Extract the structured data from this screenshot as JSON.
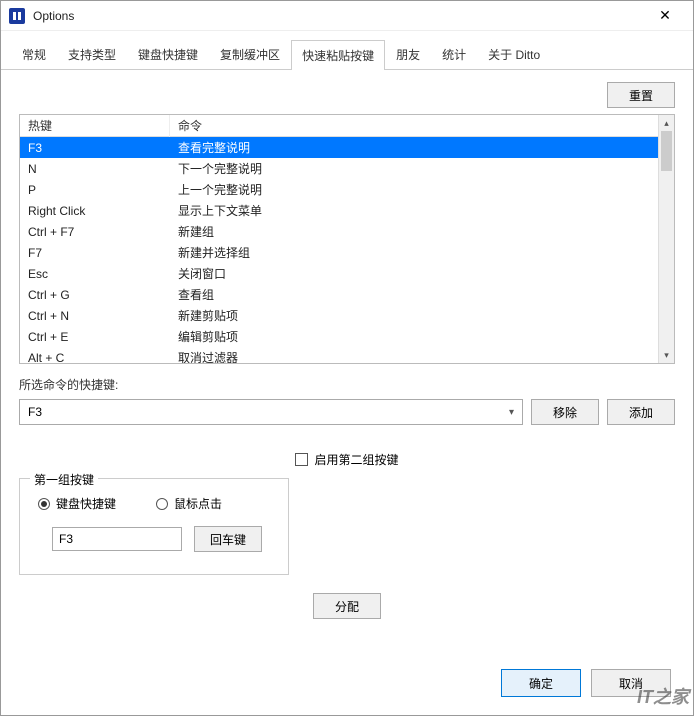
{
  "window": {
    "title": "Options"
  },
  "tabs": [
    {
      "label": "常规"
    },
    {
      "label": "支持类型"
    },
    {
      "label": "键盘快捷键"
    },
    {
      "label": "复制缓冲区"
    },
    {
      "label": "快速粘贴按键",
      "active": true
    },
    {
      "label": "朋友"
    },
    {
      "label": "统计"
    },
    {
      "label": "关于 Ditto"
    }
  ],
  "buttons": {
    "reset": "重置",
    "remove": "移除",
    "add": "添加",
    "enter": "回车键",
    "assign": "分配",
    "ok": "确定",
    "cancel": "取消"
  },
  "table": {
    "headers": {
      "hotkey": "热键",
      "command": "命令"
    },
    "rows": [
      {
        "hotkey": "F3",
        "command": "查看完整说明",
        "selected": true
      },
      {
        "hotkey": "N",
        "command": "下一个完整说明"
      },
      {
        "hotkey": "P",
        "command": "上一个完整说明"
      },
      {
        "hotkey": "Right Click",
        "command": "显示上下文菜单"
      },
      {
        "hotkey": "Ctrl  +  F7",
        "command": "新建组"
      },
      {
        "hotkey": "F7",
        "command": "新建并选择组"
      },
      {
        "hotkey": "Esc",
        "command": "关闭窗口"
      },
      {
        "hotkey": "Ctrl  +  G",
        "command": "查看组"
      },
      {
        "hotkey": "Ctrl  +  N",
        "command": "新建剪贴项"
      },
      {
        "hotkey": "Ctrl  +  E",
        "command": "编辑剪贴项"
      },
      {
        "hotkey": "Alt  +  C",
        "command": "取消过滤器"
      }
    ]
  },
  "selected_label": "所选命令的快捷键:",
  "selected_value": "F3",
  "enable_second": "启用第二组按键",
  "group1": {
    "legend": "第一组按键",
    "radio_keyboard": "键盘快捷键",
    "radio_mouse": "鼠标点击",
    "input_value": "F3"
  },
  "watermark": "IT之家"
}
